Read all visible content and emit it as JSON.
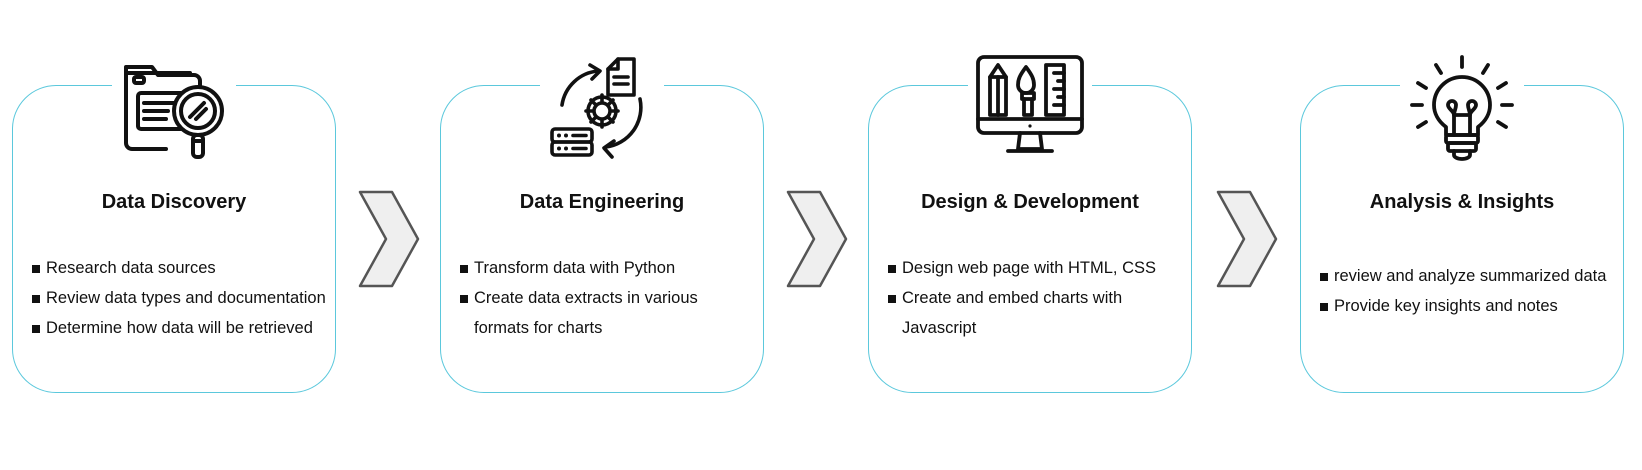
{
  "steps": [
    {
      "title": "Data Discovery",
      "icon": "folder-magnifier-icon",
      "bullets": [
        "Research data sources",
        "Review data types and documentation",
        "Determine how data will be retrieved"
      ]
    },
    {
      "title": "Data Engineering",
      "icon": "gear-cycle-server-icon",
      "bullets": [
        "Transform data with Python",
        "Create data extracts in various formats for charts"
      ]
    },
    {
      "title": "Design & Development",
      "icon": "monitor-design-tools-icon",
      "bullets": [
        "Design web page with HTML, CSS",
        "Create and embed charts with Javascript"
      ]
    },
    {
      "title": "Analysis & Insights",
      "icon": "lightbulb-icon",
      "bullets": [
        "review and analyze summarized data",
        "Provide key insights and notes"
      ]
    }
  ],
  "colors": {
    "card_border": "#5bc8dc",
    "arrow_fill": "#efefef",
    "arrow_stroke": "#555555",
    "text": "#111111"
  }
}
